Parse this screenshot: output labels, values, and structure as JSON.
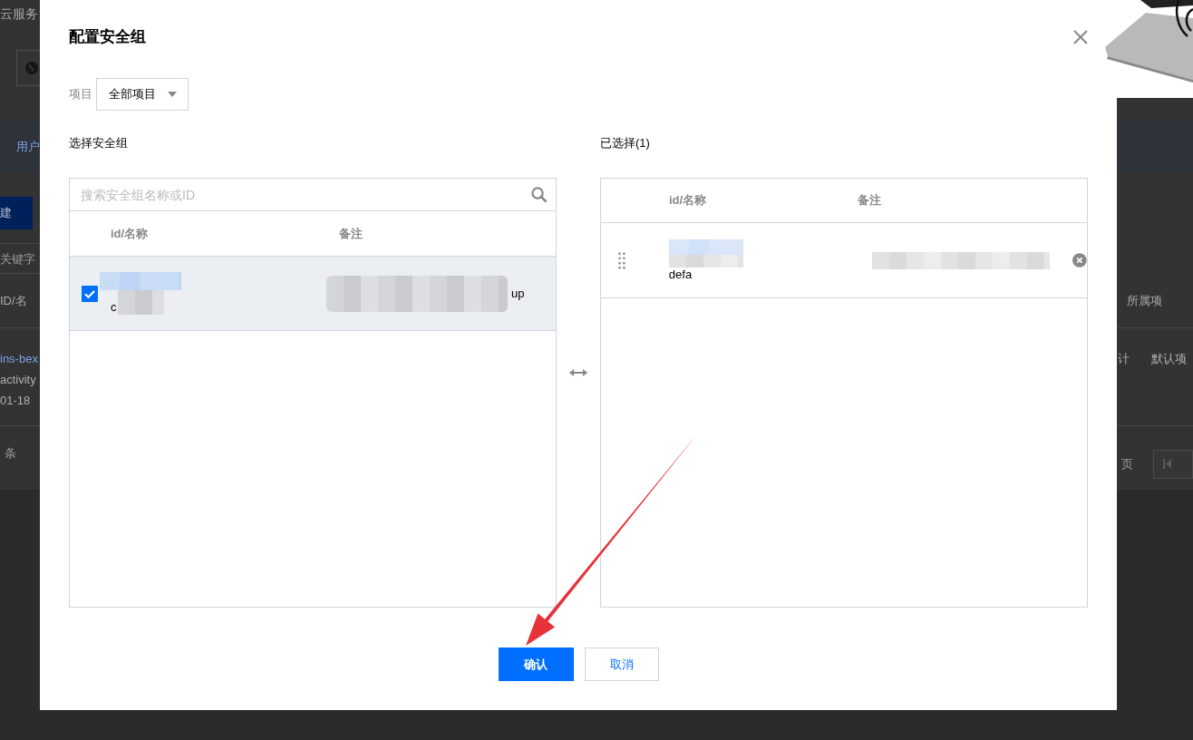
{
  "background_page": {
    "title": "云服务",
    "tabs": [
      {
        "label": "用户",
        "selected": true
      }
    ],
    "create_button": {
      "label": "建"
    },
    "search": {
      "placeholder": "关键字"
    },
    "table": {
      "columns": [
        "ID/名",
        "所属项"
      ],
      "rows": [
        {
          "id": "ins-bex",
          "name": "activity",
          "date": "01-18",
          "column_3": "计",
          "project": "默认项"
        }
      ]
    },
    "pagination": {
      "total": "条",
      "pages": "页"
    }
  },
  "dialog": {
    "title": "配置安全组",
    "project": {
      "label": "项目",
      "value": "全部项目"
    },
    "source": {
      "title": "选择安全组",
      "search": {
        "placeholder": "搜索安全组名称或ID"
      },
      "columns": [
        "id/名称",
        "备注"
      ],
      "rows": [
        {
          "checked": true,
          "name": "c",
          "remark": "up"
        }
      ]
    },
    "target": {
      "title": "已选择(1)",
      "columns": [
        "id/名称",
        "备注"
      ],
      "rows": [
        {
          "name": "defa"
        }
      ]
    },
    "buttons": [
      {
        "label": "确认",
        "kind": "primary"
      },
      {
        "label": "取消",
        "kind": "secondary"
      }
    ]
  }
}
